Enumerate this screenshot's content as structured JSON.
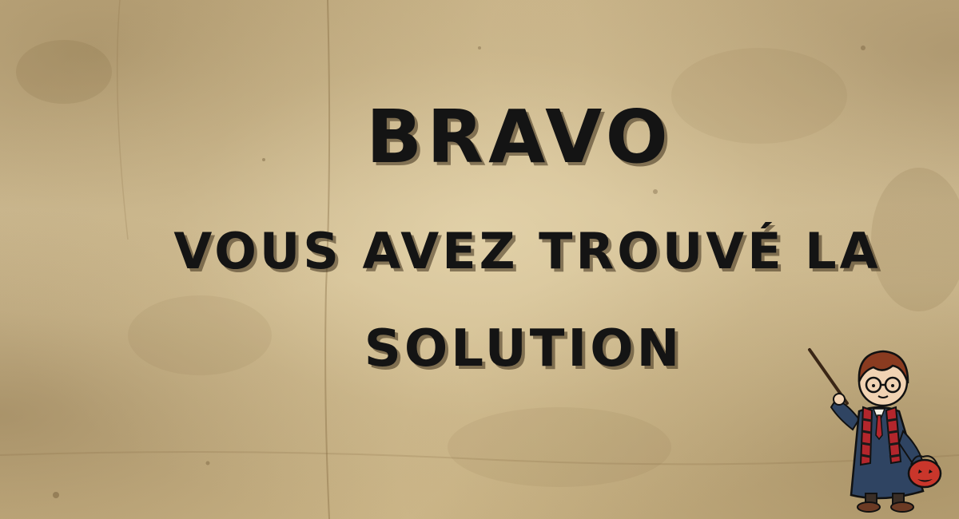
{
  "message": {
    "title": "BRAVO",
    "line1": "VOUS AVEZ TROUVÉ LA",
    "line2": "SOLUTION"
  },
  "illustration": {
    "subject": "wizard-boy-icon"
  },
  "colors": {
    "parchment": "#cdb88d",
    "text": "#141414",
    "scarf_red": "#b3262c",
    "robe": "#2f4462"
  }
}
